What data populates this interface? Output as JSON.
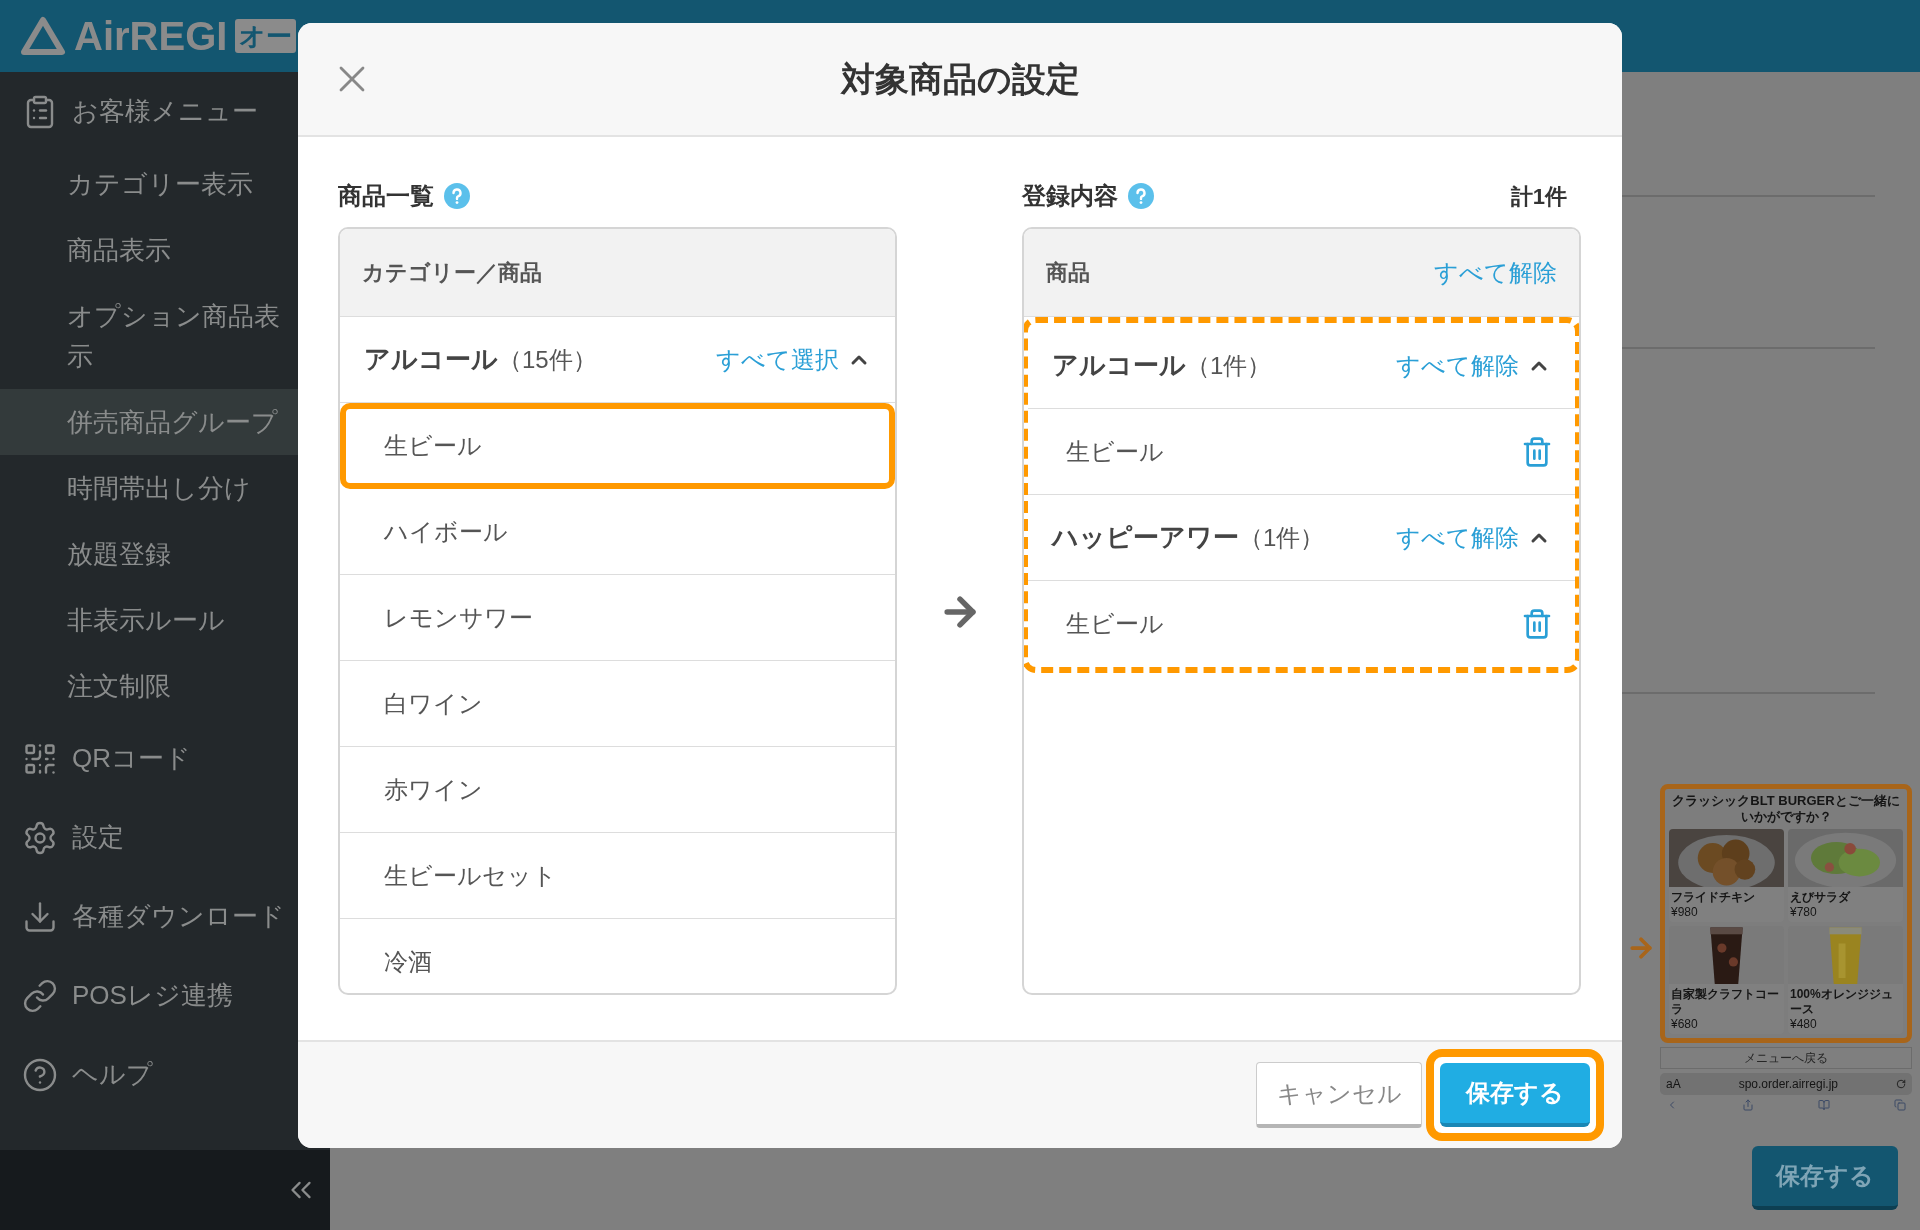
{
  "header": {
    "logo": "AirREGI",
    "badge": "オー"
  },
  "sidebar": {
    "sections": [
      {
        "label": "お客様メニュー",
        "children": [
          {
            "label": "カテゴリー表示",
            "selected": false
          },
          {
            "label": "商品表示",
            "selected": false
          },
          {
            "label": "オプション商品表示",
            "selected": false
          },
          {
            "label": "併売商品グループ",
            "selected": true
          },
          {
            "label": "時間帯出し分け",
            "selected": false
          },
          {
            "label": "放題登録",
            "selected": false
          },
          {
            "label": "非表示ルール",
            "selected": false
          },
          {
            "label": "注文制限",
            "selected": false
          }
        ]
      },
      {
        "label": "QRコード"
      },
      {
        "label": "設定"
      },
      {
        "label": "各種ダウンロード"
      },
      {
        "label": "POSレジ連携"
      },
      {
        "label": "ヘルプ"
      }
    ]
  },
  "page": {
    "preview": {
      "heading": "クラッシックBLT BURGERとご一緒にいかがですか？",
      "items": [
        {
          "name": "フライドチキン",
          "price": "¥980"
        },
        {
          "name": "えびサラダ",
          "price": "¥780"
        },
        {
          "name": "自家製クラフトコーラ",
          "price": "¥680"
        },
        {
          "name": "100%オレンジジュース",
          "price": "¥480"
        }
      ],
      "back_button": "メニューへ戻る",
      "text_size": "aA",
      "url": "spo.order.airregi.jp"
    },
    "save_button": "保存する"
  },
  "dialog": {
    "title": "対象商品の設定",
    "products": {
      "title": "商品一覧",
      "header": "カテゴリー／商品",
      "groups": [
        {
          "name": "アルコール",
          "count": "（15件）",
          "action": "すべて選択",
          "expanded": true,
          "items": [
            {
              "name": "生ビール",
              "highlighted": true
            },
            {
              "name": "ハイボール",
              "highlighted": false
            },
            {
              "name": "レモンサワー",
              "highlighted": false
            },
            {
              "name": "白ワイン",
              "highlighted": false
            },
            {
              "name": "赤ワイン",
              "highlighted": false
            },
            {
              "name": "生ビールセット",
              "highlighted": false
            },
            {
              "name": "冷酒",
              "highlighted": false
            }
          ]
        }
      ]
    },
    "registered": {
      "title": "登録内容",
      "total": "計1件",
      "header": "商品",
      "header_action": "すべて解除",
      "highlighted": true,
      "groups": [
        {
          "name": "アルコール",
          "count": "（1件）",
          "action": "すべて解除",
          "expanded": true,
          "items": [
            {
              "name": "生ビール"
            }
          ]
        },
        {
          "name": "ハッピーアワー",
          "count": "（1件）",
          "action": "すべて解除",
          "expanded": true,
          "items": [
            {
              "name": "生ビール"
            }
          ]
        }
      ]
    },
    "cancel_button": "キャンセル",
    "save_button": "保存する",
    "save_highlighted": true
  }
}
